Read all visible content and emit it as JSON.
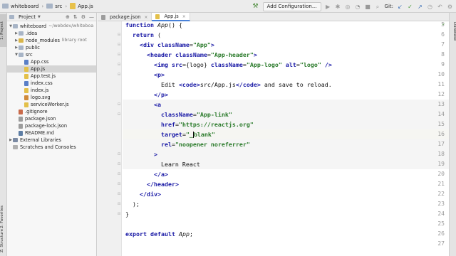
{
  "navbar": {
    "crumbs": [
      "whiteboard",
      "src",
      "App.js"
    ],
    "config_label": "Add Configuration...",
    "git_label": "Git:"
  },
  "left_strip": {
    "tabs": [
      "1: Project",
      "2: Favorites",
      "Z: Structure"
    ]
  },
  "right_strip": {
    "tabs": [
      "Database"
    ]
  },
  "project_panel": {
    "title": "Project",
    "tree": [
      {
        "label": "whiteboard",
        "hint": "~/webdev/whiteboa",
        "icon": "folder-icon",
        "expanded": true,
        "depth": 0
      },
      {
        "label": ".idea",
        "icon": "folder-icon",
        "expanded": false,
        "depth": 1
      },
      {
        "label": "node_modules",
        "hint": "library root",
        "icon": "folder-icon",
        "expanded": false,
        "depth": 1
      },
      {
        "label": "public",
        "icon": "folder-icon",
        "expanded": false,
        "depth": 1
      },
      {
        "label": "src",
        "icon": "folder-icon",
        "expanded": true,
        "depth": 1
      },
      {
        "label": "App.css",
        "icon": "css-file-icon",
        "depth": 2
      },
      {
        "label": "App.js",
        "icon": "js-file-icon",
        "depth": 2,
        "selected": true
      },
      {
        "label": "App.test.js",
        "icon": "js-file-icon",
        "depth": 2
      },
      {
        "label": "index.css",
        "icon": "css-file-icon",
        "depth": 2
      },
      {
        "label": "index.js",
        "icon": "js-file-icon",
        "depth": 2
      },
      {
        "label": "logo.svg",
        "icon": "svg-file-icon",
        "depth": 2
      },
      {
        "label": "serviceWorker.js",
        "icon": "js-file-icon",
        "depth": 2
      },
      {
        "label": ".gitignore",
        "icon": "git-file-icon",
        "depth": 1
      },
      {
        "label": "package.json",
        "icon": "json-file-icon",
        "depth": 1
      },
      {
        "label": "package-lock.json",
        "icon": "json-file-icon",
        "depth": 1
      },
      {
        "label": "README.md",
        "icon": "md-file-icon",
        "depth": 1
      },
      {
        "label": "External Libraries",
        "icon": "library-icon",
        "expanded": false,
        "depth": 0
      },
      {
        "label": "Scratches and Consoles",
        "icon": "scratch-icon",
        "depth": 0
      }
    ]
  },
  "tabs": [
    {
      "label": "package.json",
      "active": false
    },
    {
      "label": "App.js",
      "active": true
    }
  ],
  "editor": {
    "line_numbers": [
      "5",
      "6",
      "7",
      "8",
      "9",
      "10",
      "11",
      "12",
      "13",
      "14",
      "15",
      "16",
      "17",
      "18",
      "19",
      "20",
      "21",
      "22",
      "23",
      "24",
      "25",
      "26",
      "27"
    ],
    "lines": [
      "function App() {",
      "  return (",
      "    <div className=\"App\">",
      "      <header className=\"App-header\">",
      "        <img src={logo} className=\"App-logo\" alt=\"logo\" />",
      "        <p>",
      "          Edit <code>src/App.js</code> and save to reload.",
      "        </p>",
      "        <a",
      "          className=\"App-link\"",
      "          href=\"https://reactjs.org\"",
      "          target=\"_blank\"",
      "          rel=\"noopener noreferrer\"",
      "        >",
      "          Learn React",
      "        </a>",
      "      </header>",
      "    </div>",
      "  );",
      "}",
      "",
      "export default App;",
      ""
    ]
  }
}
